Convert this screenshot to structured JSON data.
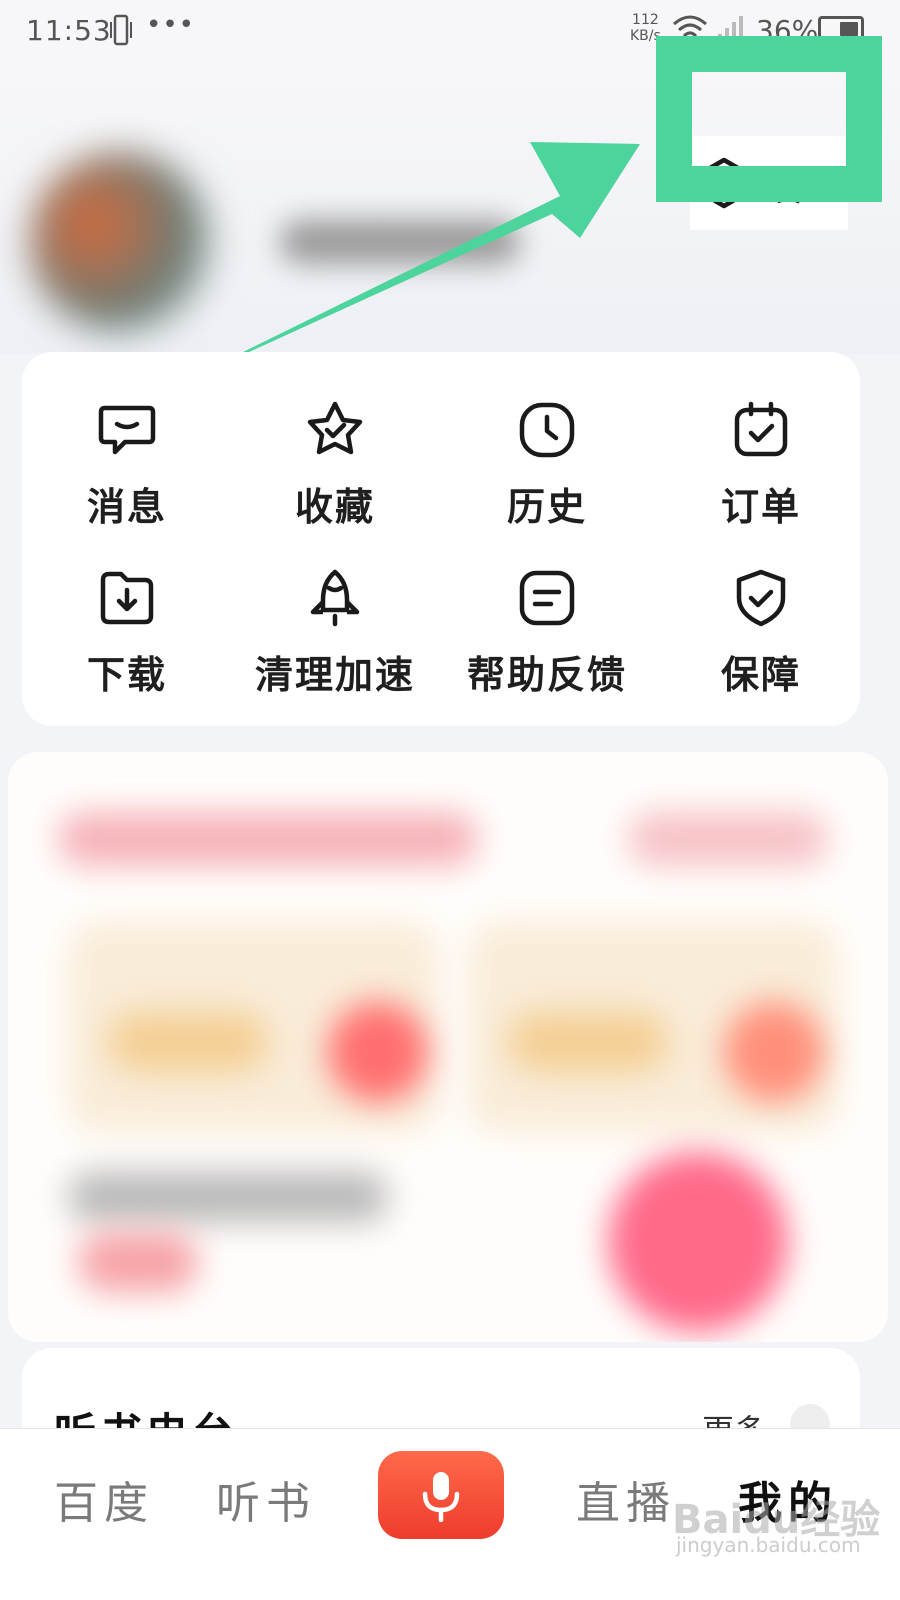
{
  "status_bar": {
    "time": "11:53",
    "dots": "•••",
    "net_speed_value": "112",
    "net_speed_unit": "KB/s",
    "battery": "36%"
  },
  "header": {
    "settings_label": "设置",
    "highlight_color": "#4dd49c"
  },
  "quick_actions": [
    {
      "label": "消息",
      "icon": "message-icon"
    },
    {
      "label": "收藏",
      "icon": "star-icon"
    },
    {
      "label": "历史",
      "icon": "clock-icon"
    },
    {
      "label": "订单",
      "icon": "calendar-check-icon"
    },
    {
      "label": "下载",
      "icon": "download-icon"
    },
    {
      "label": "清理加速",
      "icon": "rocket-icon"
    },
    {
      "label": "帮助反馈",
      "icon": "feedback-icon"
    },
    {
      "label": "保障",
      "icon": "shield-check-icon"
    }
  ],
  "audio_section": {
    "title": "听书电台",
    "more_label": "更多"
  },
  "bottom_nav": {
    "items": [
      {
        "label": "百度"
      },
      {
        "label": "听书"
      },
      {
        "label": "直播"
      },
      {
        "label": "我的"
      }
    ],
    "mic_icon": "microphone-icon",
    "mic_color": "#ef4430"
  },
  "watermark": {
    "text": "Baidu经验",
    "sub": "jingyan.baidu.com"
  }
}
